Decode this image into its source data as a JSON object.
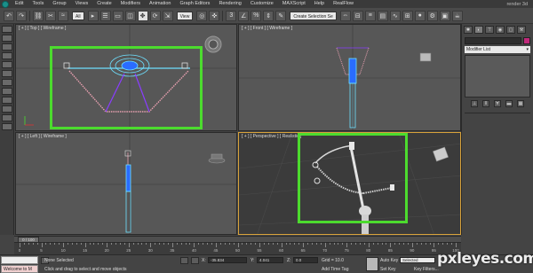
{
  "menu": {
    "items": [
      "Edit",
      "Tools",
      "Group",
      "Views",
      "Create",
      "Modifiers",
      "Animation",
      "Graph Editors",
      "Rendering",
      "Customize",
      "MAXScript",
      "Help",
      "RealFlow"
    ],
    "search_label": "render 3d"
  },
  "toolbar": {
    "selection_filter": "All",
    "view_dropdown": "View",
    "named_selection": "Create Selection Se"
  },
  "viewports": {
    "top": {
      "label": "[ + ] [ Top ] [ Wireframe ]"
    },
    "front": {
      "label": "[ + ] [ Front ] [ Wireframe ]"
    },
    "left": {
      "label": "[ + ] [ Left ] [ Wireframe ]"
    },
    "perspective": {
      "label": "[ + ] [ Perspective ] [ Realistic ]"
    }
  },
  "command_panel": {
    "modifier_list": "Modifier List"
  },
  "timeline": {
    "frame_counter": "0 / 100",
    "ticks": [
      "0",
      "5",
      "10",
      "15",
      "20",
      "25",
      "30",
      "35",
      "40",
      "45",
      "50",
      "55",
      "60",
      "65",
      "70",
      "75",
      "80",
      "85",
      "90",
      "95",
      "100"
    ]
  },
  "status": {
    "welcome": "Welcome to M",
    "selection": "None Selected",
    "prompt": "Click and drag to select and move objects",
    "x_label": "X:",
    "x_value": "-35.834",
    "y_label": "Y:",
    "y_value": "4.041",
    "z_label": "Z:",
    "z_value": "0.0",
    "grid": "Grid = 10.0",
    "auto_key": "Auto Key",
    "set_key": "Set Key",
    "selected_dropdown": "Selected",
    "key_filters": "Key Filters...",
    "add_time_tag": "Add Time Tag"
  },
  "watermark": "pxleyes.com",
  "colors": {
    "highlight": "#4cdb2e",
    "wire_cyan": "#6ee0ff",
    "wire_purple": "#8a3dff",
    "spring_pink": "#e8a0b0",
    "active_border": "#d8a23a"
  }
}
